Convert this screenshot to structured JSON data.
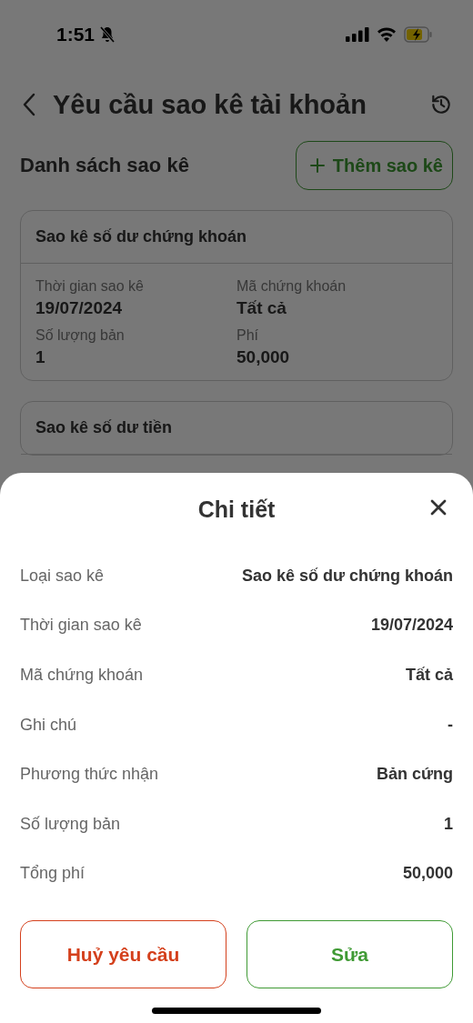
{
  "status_bar": {
    "time": "1:51"
  },
  "header": {
    "title": "Yêu cầu sao kê tài khoản"
  },
  "section": {
    "title": "Danh sách sao kê",
    "add_button": "Thêm sao kê"
  },
  "cards": [
    {
      "title": "Sao kê số dư chứng khoán",
      "fields": [
        {
          "label": "Thời gian sao kê",
          "value": "19/07/2024"
        },
        {
          "label": "Mã chứng khoán",
          "value": "Tất cả"
        },
        {
          "label": "Số lượng bản",
          "value": "1"
        },
        {
          "label": "Phí",
          "value": "50,000"
        }
      ]
    },
    {
      "title": "Sao kê số dư tiền"
    }
  ],
  "sheet": {
    "title": "Chi tiết",
    "rows": [
      {
        "label": "Loại sao kê",
        "value": "Sao kê số dư chứng khoán"
      },
      {
        "label": "Thời gian sao kê",
        "value": "19/07/2024"
      },
      {
        "label": "Mã chứng khoán",
        "value": "Tất cả"
      },
      {
        "label": "Ghi chú",
        "value": "-"
      },
      {
        "label": "Phương thức nhận",
        "value": "Bản cứng"
      },
      {
        "label": "Số lượng bản",
        "value": "1"
      },
      {
        "label": "Tổng phí",
        "value": "50,000"
      }
    ],
    "buttons": [
      {
        "label": "Huỷ yêu cầu",
        "kind": "cancel"
      },
      {
        "label": "Sửa",
        "kind": "edit"
      }
    ]
  }
}
